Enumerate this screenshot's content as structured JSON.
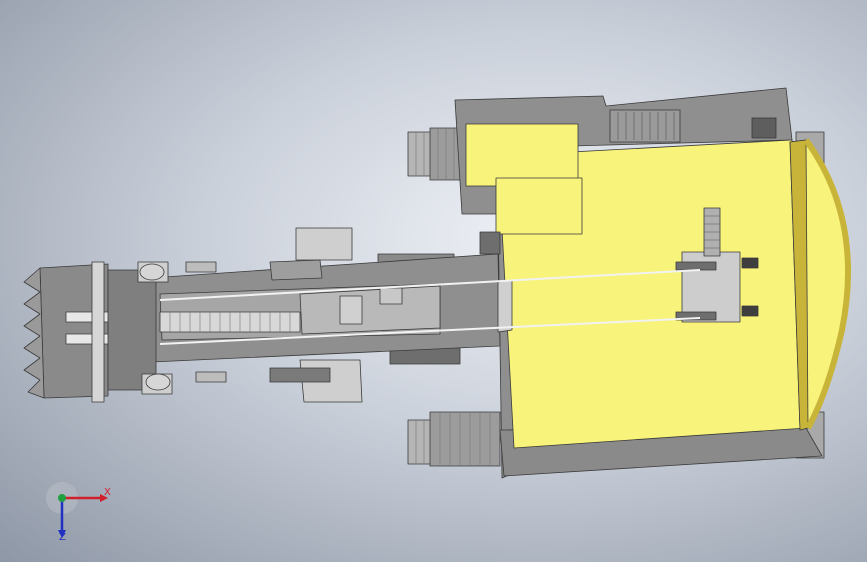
{
  "viewport": {
    "background_center": "#eef1f6",
    "background_edge": "#8e97a6"
  },
  "model": {
    "name": "excavator-top-view",
    "colors": {
      "body_yellow": "#f7f37b",
      "frame_gray": "#8f8f8f",
      "dark_gray": "#6e6e6e",
      "light_gray": "#cdcdcd",
      "track_gray": "#a9a9a9",
      "outline": "#3a3a3a",
      "edge_gold": "#c9b43a"
    },
    "parts": [
      "upper-frame",
      "cab-roof",
      "counterweight",
      "left-track",
      "right-track",
      "boom",
      "stick",
      "hydraulic-cylinder",
      "bucket"
    ]
  },
  "triad": {
    "x_label": "X",
    "z_label": "Z",
    "x_color": "#d0202a",
    "y_color": "#20a040",
    "z_color": "#2030c0"
  }
}
